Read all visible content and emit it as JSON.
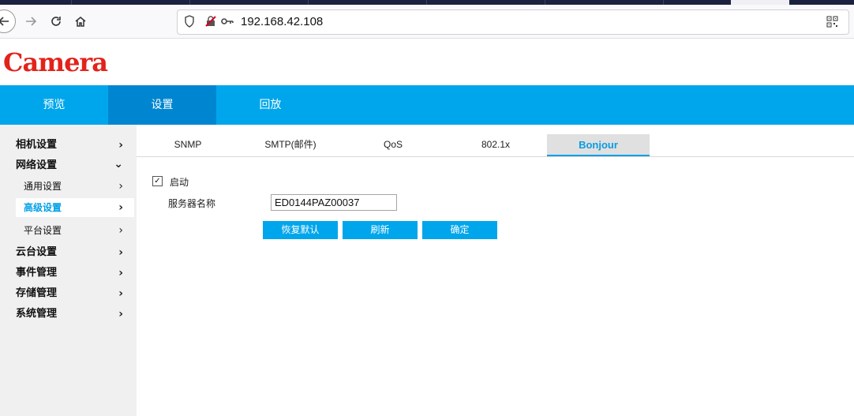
{
  "browser": {
    "url": "192.168.42.108",
    "back_icon": "arrow-left",
    "forward_icon": "arrow-right",
    "reload_icon": "reload",
    "home_icon": "home"
  },
  "app": {
    "logo": "Camera",
    "accent_color": "#00a6eb",
    "logo_color": "#e2231a"
  },
  "main_nav": {
    "items": [
      {
        "label": "预览"
      },
      {
        "label": "设置",
        "active": true
      },
      {
        "label": "回放"
      }
    ]
  },
  "sidebar": {
    "items": [
      {
        "label": "相机设置",
        "level": 1,
        "chevron": "right"
      },
      {
        "label": "网络设置",
        "level": 1,
        "chevron": "down"
      },
      {
        "label": "通用设置",
        "level": 2,
        "chevron": "right"
      },
      {
        "label": "高级设置",
        "level": 2,
        "chevron": "right",
        "active": true
      },
      {
        "label": "平台设置",
        "level": 2,
        "chevron": "right"
      },
      {
        "label": "云台设置",
        "level": 1,
        "chevron": "right"
      },
      {
        "label": "事件管理",
        "level": 1,
        "chevron": "right"
      },
      {
        "label": "存储管理",
        "level": 1,
        "chevron": "right"
      },
      {
        "label": "系统管理",
        "level": 1,
        "chevron": "right"
      }
    ]
  },
  "subtabs": {
    "items": [
      {
        "label": "SNMP"
      },
      {
        "label": "SMTP(邮件)"
      },
      {
        "label": "QoS"
      },
      {
        "label": "802.1x"
      },
      {
        "label": "Bonjour",
        "active": true
      }
    ]
  },
  "form": {
    "enable_label": "启动",
    "enable_checked": true,
    "server_name_label": "服务器名称",
    "server_name_value": "ED0144PAZ00037",
    "restore_default_label": "恢复默认",
    "refresh_label": "刷新",
    "confirm_label": "确定"
  }
}
